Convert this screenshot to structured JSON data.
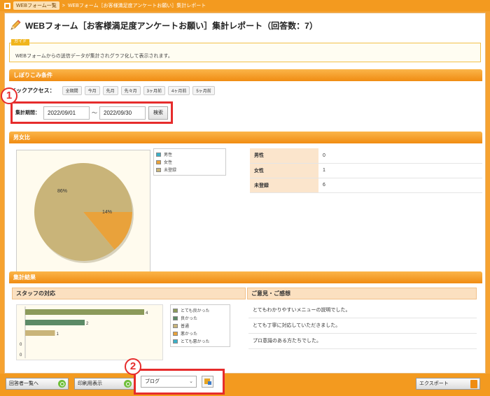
{
  "breadcrumb": {
    "home_chip": "WEBフォーム一覧",
    "current": "WEBフォーム［お客様満足度アンケートお願い］集計レポート"
  },
  "header": {
    "title": "WEBフォーム［お客様満足度アンケートお願い］集計レポート（回答数：7）"
  },
  "guide": {
    "tag": "ガイド",
    "text": "WEBフォームからの送信データが集計されグラフ化して表示されます。"
  },
  "filter": {
    "section_title": "しぼりこみ条件",
    "quick_label": "イックアクセス：",
    "quick_buttons": [
      "全期間",
      "今月",
      "先月",
      "先々月",
      "3ヶ月前",
      "4ヶ月前",
      "5ヶ月前"
    ],
    "period_label": "集計期間：",
    "date_from": "2022/09/01",
    "tilde": "～",
    "date_to": "2022/09/30",
    "search_label": "検索"
  },
  "badges": {
    "one": "1",
    "two": "2"
  },
  "gender": {
    "section_title": "男女比",
    "legend": [
      "男性",
      "女性",
      "未登録"
    ],
    "table": [
      {
        "label": "男性",
        "value": "0"
      },
      {
        "label": "女性",
        "value": "1"
      },
      {
        "label": "未登録",
        "value": "6"
      }
    ],
    "slice_labels": {
      "major": "86%",
      "minor": "14%"
    }
  },
  "results": {
    "section_title": "集計結果",
    "staff_title": "スタッフの対応",
    "staff_legend": [
      "とても良かった",
      "良かった",
      "普通",
      "悪かった",
      "とても悪かった"
    ],
    "opinions_title": "ご意見・ご感想",
    "opinions": [
      "とてもわかりやすいメニューの説明でした。",
      "とても丁寧に対応していただきました。",
      "プロ意識のある方たちでした。"
    ]
  },
  "toolbar": {
    "respondents": "回答者一覧へ",
    "print": "印刷用表示",
    "select_value": "ブログ",
    "export": "エクスポート"
  },
  "colors": {
    "accent": "#f39a1f",
    "highlight": "#e62c2c",
    "pie_major": "#c9b479",
    "pie_minor": "#e9a23b",
    "bar_1": "#8c9a5a",
    "bar_2": "#5c8a66",
    "bar_3": "#c9b479"
  },
  "chart_data": [
    {
      "type": "pie",
      "title": "男女比",
      "categories": [
        "男性",
        "女性",
        "未登録"
      ],
      "values": [
        0,
        14,
        86
      ],
      "unit": "%"
    },
    {
      "type": "bar",
      "title": "スタッフの対応",
      "categories": [
        "とても良かった",
        "良かった",
        "普通",
        "悪かった",
        "とても悪かった"
      ],
      "values": [
        4,
        2,
        1,
        0,
        0
      ],
      "orientation": "horizontal"
    }
  ]
}
